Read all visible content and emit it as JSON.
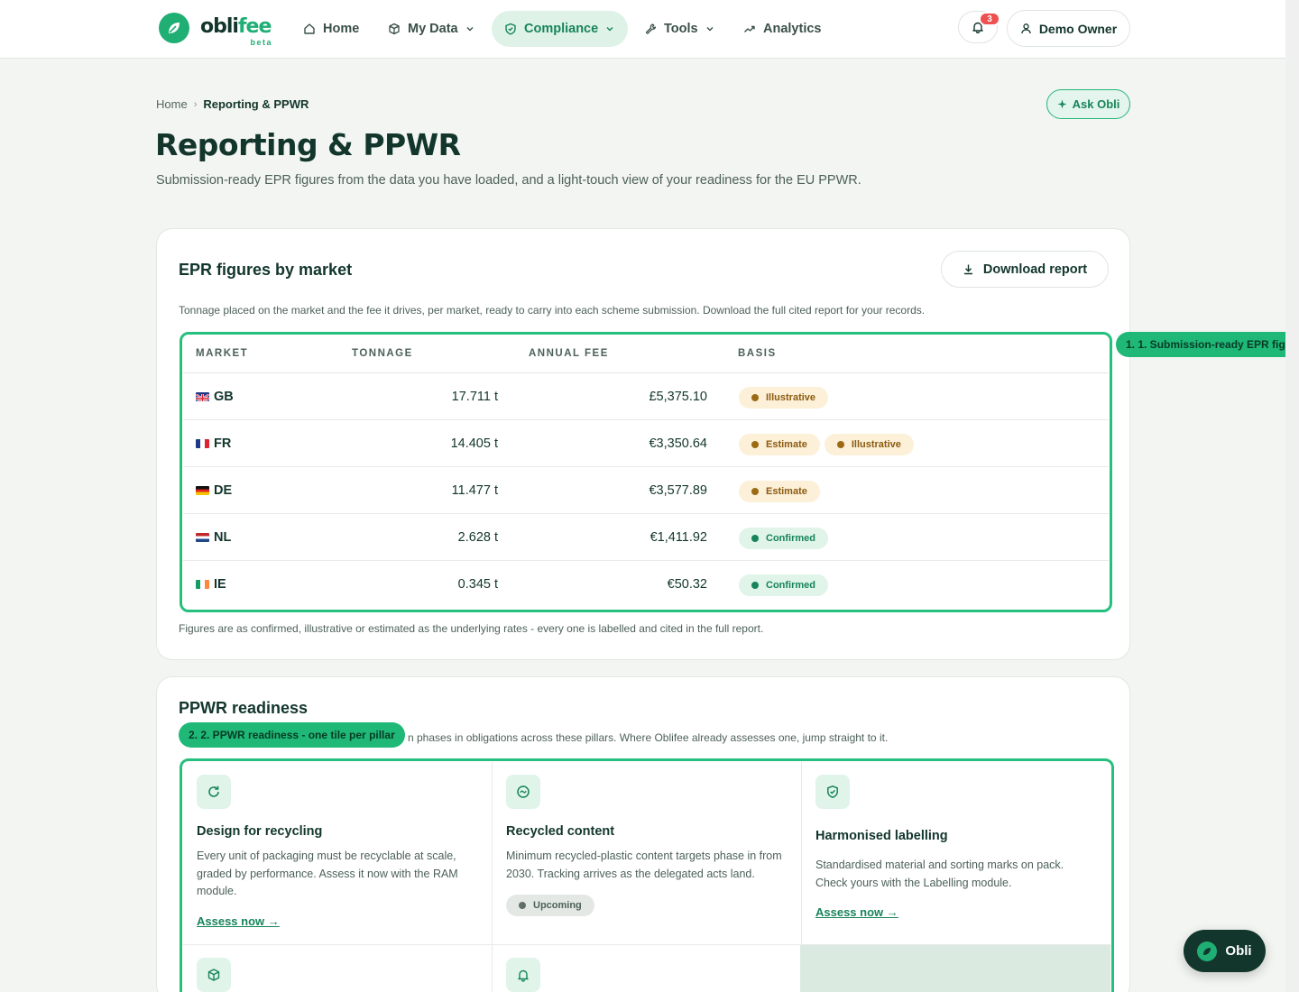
{
  "brand": {
    "name_a": "obli",
    "name_b": "fee",
    "badge": "beta"
  },
  "nav": {
    "items": [
      {
        "label": "Home",
        "icon": "home-icon"
      },
      {
        "label": "My Data",
        "icon": "cube-icon"
      },
      {
        "label": "Compliance",
        "icon": "shield-icon"
      },
      {
        "label": "Tools",
        "icon": "wrench-icon"
      },
      {
        "label": "Analytics",
        "icon": "trend-icon"
      }
    ],
    "notifications": "3",
    "user": "Demo Owner"
  },
  "breadcrumb": {
    "home": "Home",
    "sep": "›",
    "current": "Reporting & PPWR"
  },
  "ask_label": "Ask Obli",
  "page": {
    "title": "Reporting & PPWR",
    "subtitle": "Submission-ready EPR figures from the data you have loaded, and a light-touch view of your readiness for the EU PPWR."
  },
  "epr": {
    "title": "EPR figures by market",
    "download": "Download report",
    "desc": "Tonnage placed on the market and the fee it drives, per market, ready to carry into each scheme submission. Download the full cited report for your records.",
    "columns": [
      "MARKET",
      "TONNAGE",
      "ANNUAL FEE",
      "BASIS"
    ],
    "rows": [
      {
        "market": "GB",
        "tonnage": "17.711 t",
        "fee": "£5,375.10",
        "basis": [
          "Illustrative"
        ]
      },
      {
        "market": "FR",
        "tonnage": "14.405 t",
        "fee": "€3,350.64",
        "basis": [
          "Estimate",
          "Illustrative"
        ]
      },
      {
        "market": "DE",
        "tonnage": "11.477 t",
        "fee": "€3,577.89",
        "basis": [
          "Estimate"
        ]
      },
      {
        "market": "NL",
        "tonnage": "2.628 t",
        "fee": "€1,411.92",
        "basis": [
          "Confirmed"
        ]
      },
      {
        "market": "IE",
        "tonnage": "0.345 t",
        "fee": "€50.32",
        "basis": [
          "Confirmed"
        ]
      }
    ],
    "footnote": "Figures are as confirmed, illustrative or estimated as the underlying rates - every one is labelled and cited in the full report.",
    "tag": "1. 1. Submission-ready EPR fig"
  },
  "ppwr": {
    "title": "PPWR readiness",
    "desc": "n phases in obligations across these pillars. Where Oblifee already assesses one, jump straight to it.",
    "tag": "2. 2. PPWR readiness - one tile per pillar",
    "tiles": [
      {
        "title": "Design for recycling",
        "text": "Every unit of packaging must be recyclable at scale, graded by performance. Assess it now with the RAM module.",
        "action": "Assess now →"
      },
      {
        "title": "Recycled content",
        "text": "Minimum recycled-plastic content targets phase in from 2030. Tracking arrives as the delegated acts land.",
        "status": "Upcoming"
      },
      {
        "title": "Harmonised labelling",
        "text": "Standardised material and sorting marks on pack. Check yours with the Labelling module.",
        "action": "Assess now →"
      }
    ]
  },
  "chat": {
    "label": "Obli"
  },
  "colors": {
    "accent": "#1fae73",
    "ink": "#12362c",
    "highlight": "#26c07e"
  }
}
